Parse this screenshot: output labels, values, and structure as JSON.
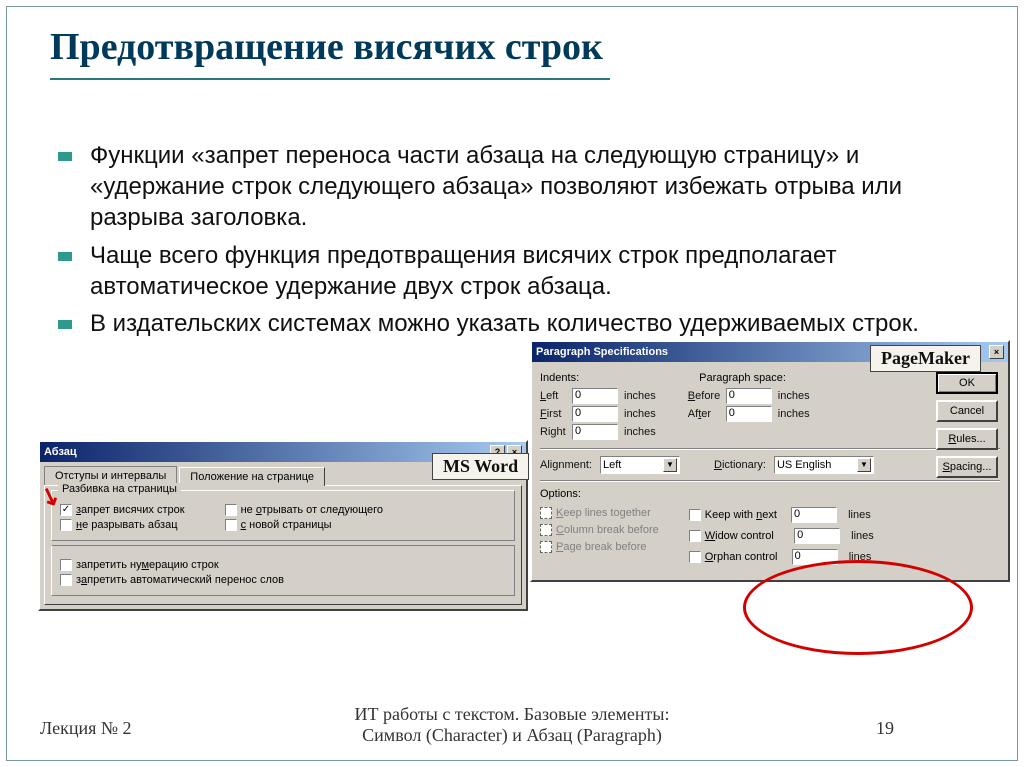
{
  "title": "Предотвращение висячих строк",
  "bullets": [
    "Функции «запрет переноса части абзаца на следующую страницу» и «удержание строк следующего абзаца» позволяют избежать отрыва или разрыва заголовка.",
    "Чаще всего функция предотвращения висячих строк предполагает автоматическое удержание двух строк абзаца.",
    "В издательских системах можно указать количество удерживаемых строк."
  ],
  "badge_word": "MS Word",
  "badge_pm": "PageMaker",
  "word": {
    "title": "Абзац",
    "tab1": "Отступы и интервалы",
    "tab2": "Положение на странице",
    "group_pagebreak": "Разбивка на страницы",
    "cb_widow": "запрет висячих строк",
    "cb_keepnext": "не отрывать от следующего",
    "cb_keeptogether": "не разрывать абзац",
    "cb_newpage": "с новой страницы",
    "cb_noline": "запретить нумерацию строк",
    "cb_nohyphen": "запретить автоматический перенос слов"
  },
  "pm": {
    "title": "Paragraph Specifications",
    "indents": "Indents:",
    "paraspace": "Paragraph space:",
    "left": "Left",
    "first": "First",
    "right": "Right",
    "before": "Before",
    "after": "After",
    "inches": "inches",
    "values": {
      "left": "0",
      "first": "0",
      "right": "0",
      "before": "0",
      "after": "0"
    },
    "alignment": "Alignment:",
    "alignment_val": "Left",
    "dictionary": "Dictionary:",
    "dictionary_val": "US English",
    "options": "Options:",
    "cb_keeplines": "Keep lines together",
    "cb_colbreak": "Column break before",
    "cb_pagebreak": "Page break before",
    "cb_keepnext": "Keep with next",
    "cb_widow": "Widow control",
    "cb_orphan": "Orphan control",
    "lines": "lines",
    "linevals": {
      "keepnext": "0",
      "widow": "0",
      "orphan": "0"
    },
    "btn_ok": "OK",
    "btn_cancel": "Cancel",
    "btn_rules": "Rules...",
    "btn_spacing": "Spacing..."
  },
  "footer": {
    "left": "Лекция № 2",
    "center1": "ИТ работы с текстом. Базовые элементы:",
    "center2": "Символ (Character)  и Абзац (Paragraph)",
    "page": "19"
  }
}
